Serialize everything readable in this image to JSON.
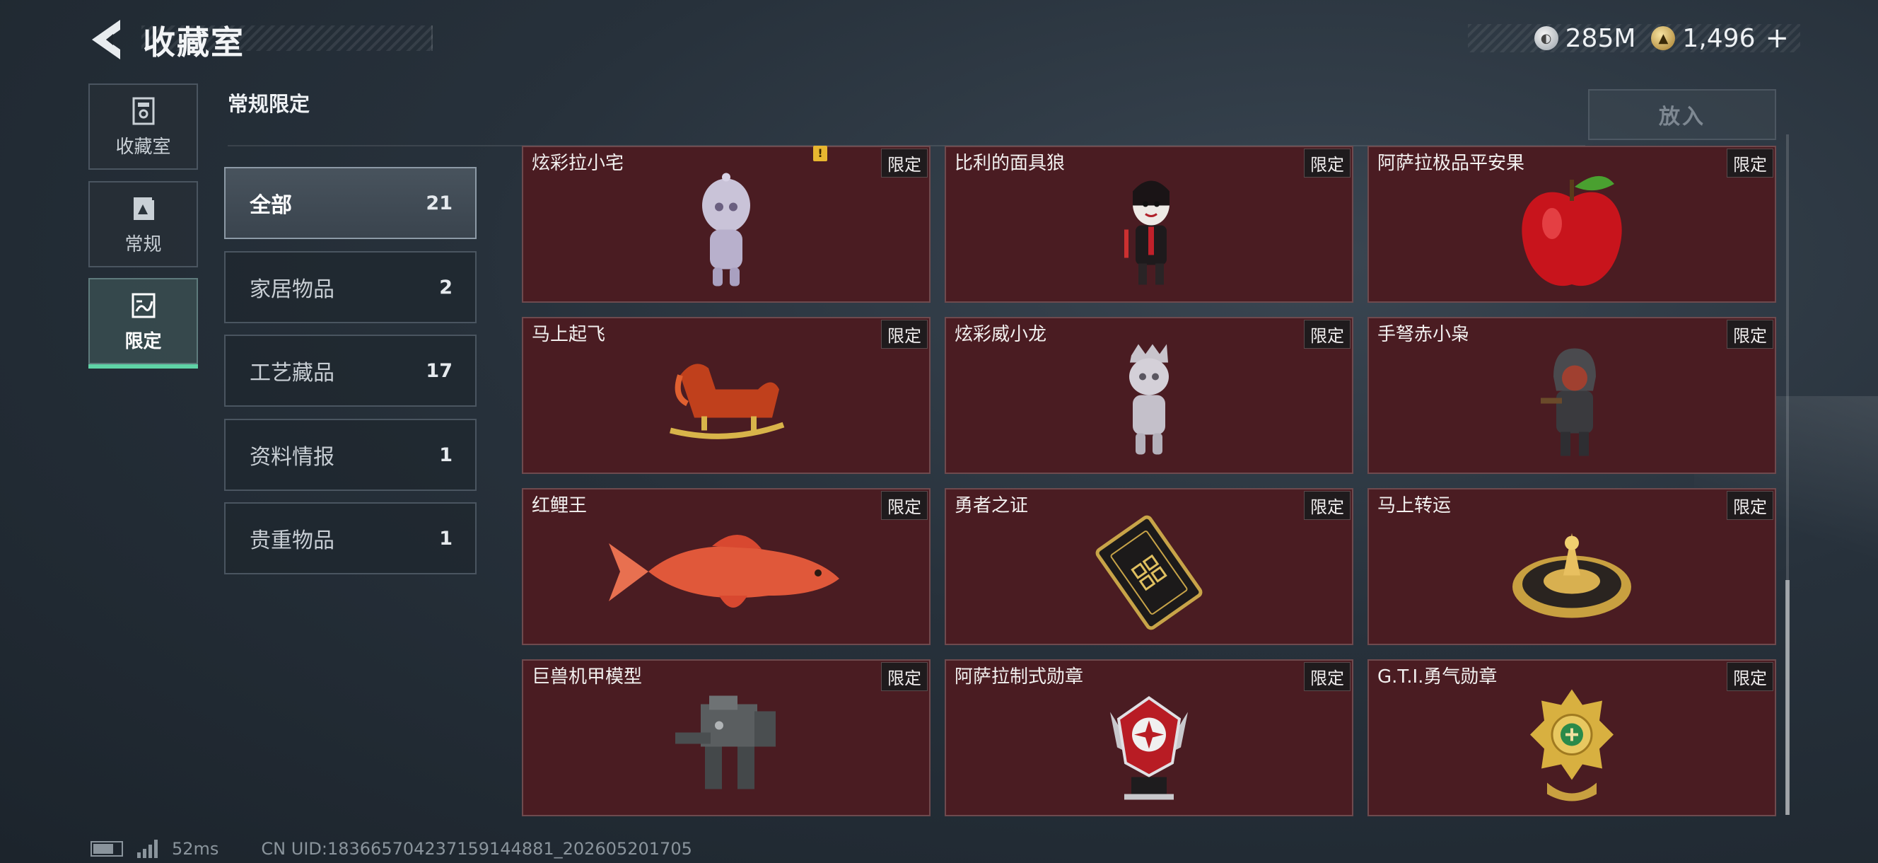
{
  "header": {
    "title": "收藏室",
    "currencies": [
      {
        "icon": "silver-coin-icon",
        "value": "285M"
      },
      {
        "icon": "gold-coin-icon",
        "value": "1,496"
      }
    ],
    "plus": "+"
  },
  "nav": [
    {
      "icon": "collection-room-icon",
      "label": "收藏室"
    },
    {
      "icon": "regular-icon",
      "label": "常规"
    },
    {
      "icon": "limited-icon",
      "label": "限定",
      "active": true
    }
  ],
  "section_title": "常规限定",
  "place_button": "放入",
  "categories": [
    {
      "label": "全部",
      "count": "21",
      "active": true
    },
    {
      "label": "家居物品",
      "count": "2"
    },
    {
      "label": "工艺藏品",
      "count": "17"
    },
    {
      "label": "资料情报",
      "count": "1"
    },
    {
      "label": "贵重物品",
      "count": "1"
    }
  ],
  "items": [
    {
      "name": "炫彩拉小宅",
      "tag": "限定",
      "icon": "figurine-icon"
    },
    {
      "name": "比利的面具狼",
      "tag": "限定",
      "icon": "puppet-figure-icon",
      "alert": "!"
    },
    {
      "name": "阿萨拉极品平安果",
      "tag": "限定",
      "icon": "apple-icon"
    },
    {
      "name": "马上起飞",
      "tag": "限定",
      "icon": "rocking-horse-icon"
    },
    {
      "name": "炫彩威小龙",
      "tag": "限定",
      "icon": "figurine-icon"
    },
    {
      "name": "手弩赤小枭",
      "tag": "限定",
      "icon": "hooded-figure-icon"
    },
    {
      "name": "红鲤王",
      "tag": "限定",
      "icon": "carp-fish-icon"
    },
    {
      "name": "勇者之证",
      "tag": "限定",
      "icon": "card-icon"
    },
    {
      "name": "马上转运",
      "tag": "限定",
      "icon": "golden-wheel-icon"
    },
    {
      "name": "巨兽机甲模型",
      "tag": "限定",
      "icon": "mech-model-icon"
    },
    {
      "name": "阿萨拉制式勋章",
      "tag": "限定",
      "icon": "medal-icon"
    },
    {
      "name": "G.T.I.勇气勋章",
      "tag": "限定",
      "icon": "gold-badge-icon"
    }
  ],
  "footer": {
    "ping": "52ms",
    "uid": "CN UID:1836657042371591448​81_202605201705"
  },
  "colors": {
    "card_bg": "#4a1c22",
    "accent_green": "#5fd3a6",
    "alert_yellow": "#e8b630"
  }
}
